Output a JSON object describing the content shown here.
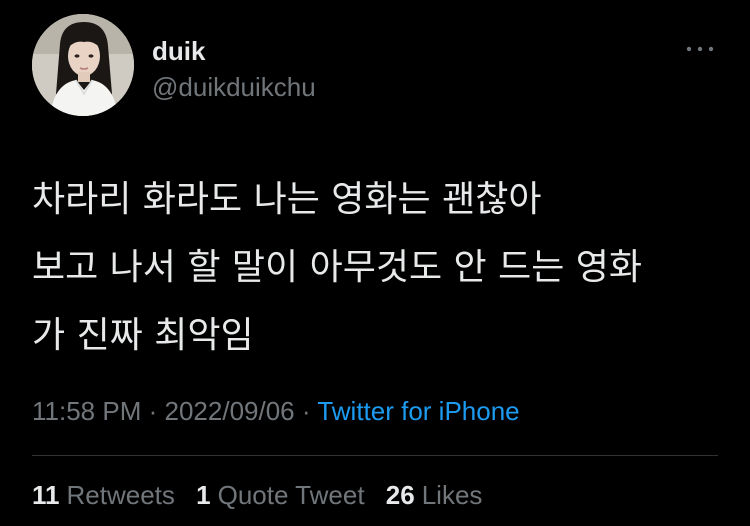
{
  "user": {
    "display_name": "duik",
    "handle": "@duikduikchu"
  },
  "more_icon": "more-horizontal-icon",
  "tweet": {
    "lines": [
      "차라리 화라도 나는 영화는 괜찮아",
      "보고 나서 할 말이 아무것도 안 드는 영화",
      "가 진짜 최악임"
    ]
  },
  "meta": {
    "time": "11:58 PM",
    "separator": "·",
    "date": "2022/09/06",
    "source": "Twitter for iPhone"
  },
  "stats": {
    "retweets_count": "11",
    "retweets_label": "Retweets",
    "quotes_count": "1",
    "quotes_label": "Quote Tweet",
    "likes_count": "26",
    "likes_label": "Likes"
  },
  "colors": {
    "background": "#000000",
    "primary_text": "#e7e9ea",
    "secondary_text": "#71767b",
    "link": "#1d9bf0",
    "divider": "#2f3336"
  }
}
